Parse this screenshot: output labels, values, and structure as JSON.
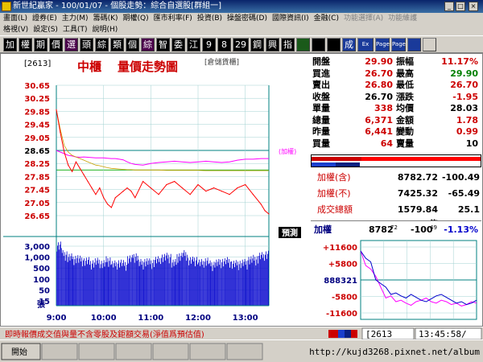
{
  "window": {
    "title": "新世紀贏家 - 100/01/07 - 個股走勢：綜合自選股[群組一]"
  },
  "menu": {
    "row1": [
      "畫面(L)",
      "證券(E)",
      "主力(M)",
      "籌碼(K)",
      "期權(Q)",
      "匯市利率(F)",
      "投資(B)",
      "操盤密碼(D)",
      "國際資訊(I)",
      "金融(C)",
      "功能選擇(A)",
      "功能維護"
    ],
    "row2": [
      "格視(V)",
      "設定(S)",
      "工具(T)",
      "說明(H)"
    ]
  },
  "toolbar": {
    "buttons": [
      "加",
      "權",
      "期",
      "價",
      "選",
      "頭",
      "綜",
      "類",
      "個",
      "綜",
      "智",
      "委",
      "江",
      "9",
      "8",
      "29",
      "鋼",
      "興",
      "指",
      "",
      "",
      "",
      "成",
      "Ex",
      "Page",
      "Page",
      "",
      ""
    ]
  },
  "stock": {
    "code": "[2613]",
    "name": "中櫃",
    "chart_title": "量價走勢圖",
    "tag": "[倉儲貨櫃]",
    "bench_label": "(加權)",
    "vol_label": "張",
    "bubble_label": "預測"
  },
  "quote": {
    "rows": [
      {
        "l": "開盤",
        "v": "29.90",
        "l2": "振幅",
        "v2": "11.17%"
      },
      {
        "l": "買進",
        "v": "26.70",
        "l2": "最高",
        "v2": "29.90"
      },
      {
        "l": "賣出",
        "v": "26.80",
        "l2": "最低",
        "v2": "26.70"
      },
      {
        "l": "收盤",
        "v": "26.70",
        "l2": "漲跌",
        "v2": "-1.95"
      },
      {
        "l": "單量",
        "v": "338",
        "l2": "均價",
        "v2": "28.03"
      },
      {
        "l": "總量",
        "v": "6,371",
        "l2": "金額",
        "v2": "1.78"
      },
      {
        "l": "昨量",
        "v": "6,441",
        "l2": "變動",
        "v2": "0.99"
      },
      {
        "l": "買量",
        "v": "64",
        "l2": "賣量",
        "v2": "10"
      }
    ]
  },
  "index": {
    "taiex_incl": {
      "label": "加權(含)",
      "value": "8782.72",
      "change": "-100.49"
    },
    "taiex_excl": {
      "label": "加權(不)",
      "value": "7425.32",
      "change": "-65.49"
    },
    "turnover": {
      "label": "成交總額",
      "value": "1579.84億",
      "change": "25.1"
    }
  },
  "mini": {
    "label": "加權",
    "value_main": "8782",
    "value_sup": "72",
    "change_main": "-100",
    "change_sup": "49",
    "pct": "-1.13%",
    "ticks": [
      "+11600",
      "+5800",
      "888321",
      "-5800",
      "-11600"
    ]
  },
  "status": {
    "notice": "即時報價成交值與量不含零股及鉅額交易(淨值爲預估值)",
    "code": "[2613",
    "time": "13:45:58/"
  },
  "taskbar": {
    "watermark": "http://kujd3268.pixnet.net/album"
  },
  "colors": {
    "up": "#cc0000",
    "down": "#008000",
    "price_line": "#ff0000",
    "avg_line": "#ff00ff",
    "volume": "#0000cc",
    "grid": "#008080"
  },
  "chart_data": {
    "type": "line",
    "price_ticks": [
      "30.65",
      "30.25",
      "29.85",
      "29.45",
      "29.05",
      "28.65",
      "28.25",
      "27.85",
      "27.45",
      "27.05",
      "26.65"
    ],
    "volume_ticks": [
      "3,000",
      "1,000",
      "500",
      "100",
      "50",
      "15"
    ],
    "time_ticks": [
      "9:00",
      "10:00",
      "11:00",
      "12:00",
      "13:00"
    ],
    "ylim": [
      26.65,
      30.65
    ],
    "reference_price": 28.65,
    "x_minutes": [
      0,
      5,
      10,
      15,
      20,
      25,
      30,
      35,
      40,
      45,
      50,
      55,
      60,
      65,
      70,
      75,
      80,
      85,
      90,
      95,
      100,
      110,
      120,
      130,
      140,
      150,
      160,
      170,
      180,
      190,
      200,
      210,
      220,
      230,
      240,
      250,
      260,
      265,
      270
    ],
    "price": [
      29.9,
      29.2,
      28.6,
      28.2,
      28.0,
      28.3,
      28.1,
      27.9,
      27.7,
      27.5,
      27.3,
      27.5,
      27.2,
      27.0,
      26.9,
      27.2,
      27.3,
      27.4,
      27.5,
      27.4,
      27.2,
      27.7,
      27.5,
      27.3,
      27.6,
      27.7,
      27.5,
      27.3,
      27.6,
      27.4,
      27.5,
      27.4,
      27.3,
      27.5,
      27.6,
      27.3,
      27.0,
      26.8,
      26.7
    ],
    "avg_price": [
      29.9,
      29.3,
      28.8,
      28.6,
      28.5,
      28.45,
      28.4,
      28.35,
      28.3,
      28.25,
      28.2,
      28.18,
      28.15,
      28.12,
      28.1,
      28.09,
      28.08,
      28.07,
      28.06,
      28.06,
      28.05,
      28.05,
      28.05,
      28.05,
      28.04,
      28.04,
      28.04,
      28.04,
      28.04,
      28.03,
      28.03,
      28.03,
      28.03,
      28.03,
      28.03,
      28.03,
      28.03,
      28.03,
      28.03
    ],
    "benchmark": [
      28.65,
      28.6,
      28.55,
      28.5,
      28.48,
      28.45,
      28.44,
      28.45,
      28.44,
      28.43,
      28.42,
      28.42,
      28.42,
      28.41,
      28.4,
      28.4,
      28.38,
      28.36,
      28.3,
      28.25,
      28.22,
      28.2,
      28.25,
      28.28,
      28.3,
      28.32,
      28.3,
      28.28,
      28.3,
      28.32,
      28.3,
      28.28,
      28.3,
      28.35,
      28.38,
      28.38,
      28.4,
      28.4,
      28.4
    ],
    "volume": [
      2800,
      900,
      600,
      520,
      450,
      380,
      300,
      350,
      280,
      420,
      250,
      300,
      260,
      500,
      700,
      300,
      350,
      320,
      420,
      600,
      650,
      300,
      700,
      900,
      400,
      450,
      300,
      380,
      250,
      300,
      350,
      380,
      260,
      280,
      300,
      450,
      500,
      700,
      900
    ],
    "volume_max": 3000,
    "xlim": [
      0,
      270
    ]
  }
}
